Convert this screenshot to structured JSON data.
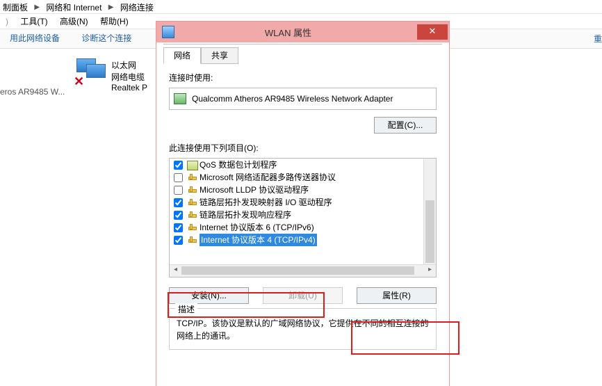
{
  "breadcrumb": {
    "a": "制面板",
    "b": "网络和 Internet",
    "c": "网络连接"
  },
  "menu": {
    "tools": "工具(T)",
    "adv": "高级(N)",
    "help": "帮助(H)"
  },
  "toolbar": {
    "use": "用此网络设备",
    "diag": "诊断这个连接",
    "rename_frag": "重"
  },
  "conn": {
    "name": "以太网",
    "desc": "网络电缆",
    "vendor": "Realtek P",
    "adapter_trunc": "eros AR9485 W..."
  },
  "dlg": {
    "title": "WLAN 属性",
    "tabs": {
      "net": "网络",
      "share": "共享"
    },
    "connect_using": "连接时使用:",
    "adapter": "Qualcomm Atheros AR9485 Wireless Network Adapter",
    "configure": "配置(C)...",
    "uses_items": "此连接使用下列项目(O):",
    "items": [
      {
        "checked": true,
        "iconClass": "q",
        "label": "QoS 数据包计划程序"
      },
      {
        "checked": false,
        "iconClass": "",
        "label": "Microsoft 网络适配器多路传送器协议"
      },
      {
        "checked": false,
        "iconClass": "",
        "label": "Microsoft LLDP 协议驱动程序"
      },
      {
        "checked": true,
        "iconClass": "",
        "label": "链路层拓扑发现映射器 I/O 驱动程序"
      },
      {
        "checked": true,
        "iconClass": "",
        "label": "链路层拓扑发现响应程序"
      },
      {
        "checked": true,
        "iconClass": "",
        "label": "Internet 协议版本 6 (TCP/IPv6)"
      },
      {
        "checked": true,
        "iconClass": "",
        "label": "Internet 协议版本 4 (TCP/IPv4)",
        "selected": true
      }
    ],
    "install": "安装(N)...",
    "uninstall": "卸载(U)",
    "props": "属性(R)",
    "desc_title": "描述",
    "desc_body": "TCP/IP。该协议是默认的广域网络协议，它提供在不同的相互连接的网络上的通讯。"
  }
}
